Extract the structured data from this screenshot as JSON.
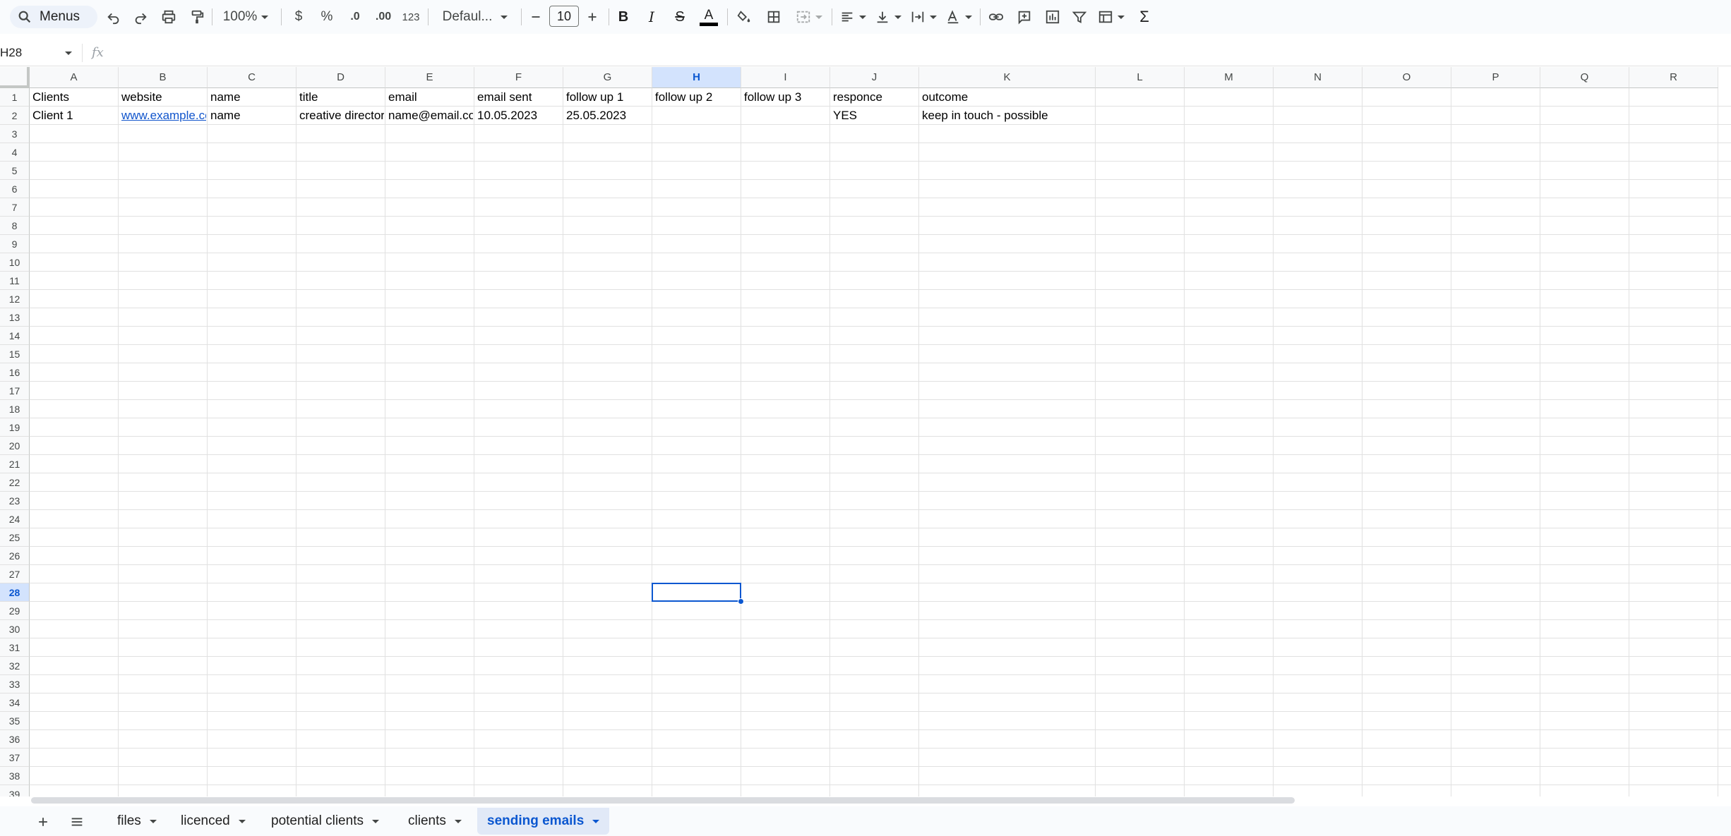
{
  "toolbar": {
    "menus_label": "Menus",
    "zoom": "100%",
    "currency": "$",
    "percent": "%",
    "decrease_decimal": ".0",
    "increase_decimal": ".00",
    "number_format": "123",
    "font": "Defaul...",
    "font_size": "10",
    "text_color": "#000000"
  },
  "formula_bar": {
    "name_box": "H28",
    "fx": "fx",
    "content": ""
  },
  "columns": [
    "A",
    "B",
    "C",
    "D",
    "E",
    "F",
    "G",
    "H",
    "I",
    "J",
    "K",
    "L",
    "M",
    "N",
    "O",
    "P",
    "Q",
    "R"
  ],
  "selected_column": "H",
  "rows": [
    "1",
    "2",
    "3",
    "4",
    "5",
    "6",
    "7",
    "8",
    "9",
    "10",
    "11",
    "12",
    "13",
    "14",
    "15",
    "16",
    "17",
    "18",
    "19",
    "20",
    "21",
    "22",
    "23",
    "24",
    "25",
    "26",
    "27",
    "28",
    "29",
    "30",
    "31",
    "32",
    "33",
    "34",
    "35",
    "36",
    "37",
    "38",
    "39"
  ],
  "selected_row": "28",
  "sheet": {
    "header_row": [
      "Clients",
      "website",
      "name",
      "title",
      "email",
      "email sent",
      "follow up 1",
      "follow up 2",
      "follow up 3",
      "responce",
      "outcome"
    ],
    "data_row": [
      "Client 1",
      "www.example.co",
      "name",
      "creative director",
      "name@email.co",
      "10.05.2023",
      "25.05.2023",
      "",
      "",
      "YES",
      "keep in touch - possible"
    ]
  },
  "tabs": [
    {
      "label": "files",
      "active": false
    },
    {
      "label": "licenced",
      "active": false
    },
    {
      "label": "potential clients",
      "active": false
    },
    {
      "label": "clients",
      "active": false
    },
    {
      "label": "sending emails",
      "active": true
    }
  ]
}
